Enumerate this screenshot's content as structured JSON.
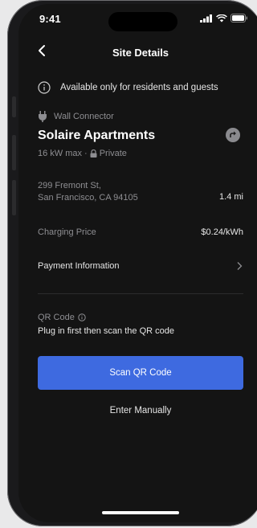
{
  "status_bar": {
    "time": "9:41"
  },
  "nav": {
    "title": "Site Details"
  },
  "notice": {
    "text": "Available only for residents and guests"
  },
  "site": {
    "connector_type": "Wall Connector",
    "name": "Solaire Apartments",
    "power": "16 kW max",
    "separator": "·",
    "access": "Private",
    "address_line1": "299 Fremont St,",
    "address_line2": "San Francisco, CA 94105",
    "distance": "1.4 mi"
  },
  "pricing": {
    "label": "Charging Price",
    "value": "$0.24/kWh"
  },
  "payment": {
    "label": "Payment Information"
  },
  "qr": {
    "label": "QR Code",
    "instruction": "Plug in first then scan the QR code",
    "scan_button": "Scan QR Code",
    "manual_link": "Enter Manually"
  },
  "colors": {
    "accent": "#3e6ae0",
    "background": "#141414",
    "muted_text": "#8e8e92"
  }
}
